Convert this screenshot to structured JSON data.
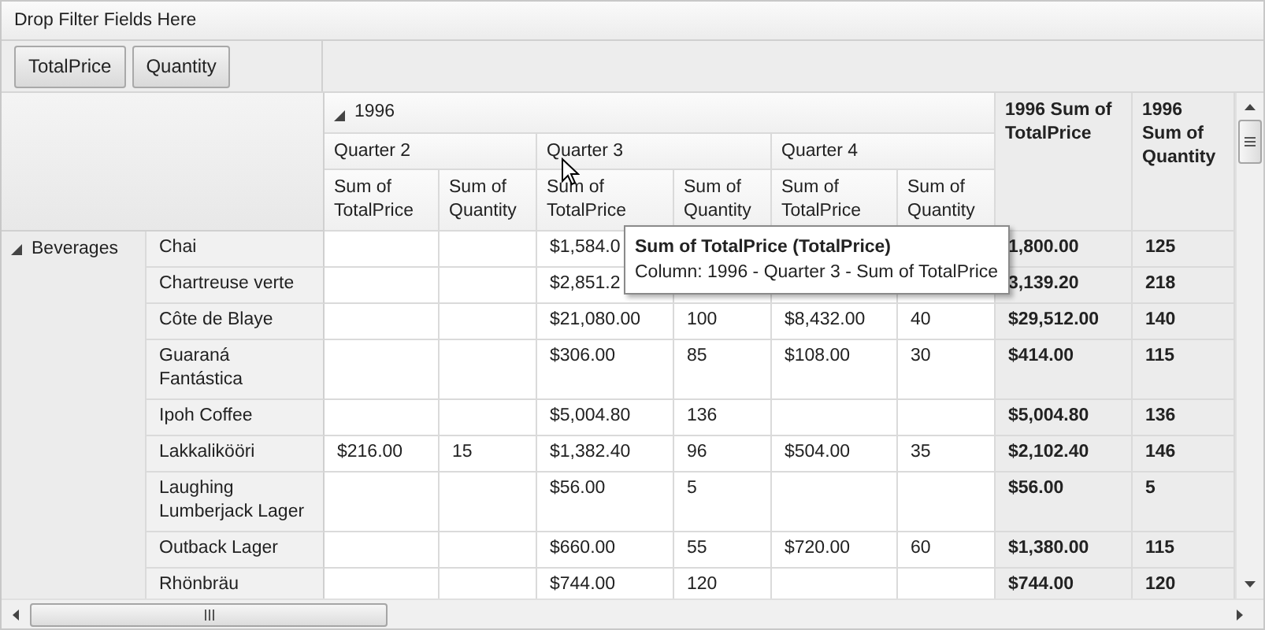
{
  "filter_drop_zone": "Drop Filter Fields Here",
  "data_fields": [
    "TotalPrice",
    "Quantity"
  ],
  "column_group": {
    "label": "1996",
    "expanded": true
  },
  "quarters": [
    {
      "label": "Quarter 2",
      "measures": [
        "Sum of TotalPrice",
        "Sum of Quantity"
      ]
    },
    {
      "label": "Quarter 3",
      "measures": [
        "Sum of TotalPrice",
        "Sum of Quantity"
      ]
    },
    {
      "label": "Quarter 4",
      "measures": [
        "Sum of TotalPrice",
        "Sum of Quantity"
      ]
    }
  ],
  "grand_totals": [
    "1996 Sum of TotalPrice",
    "1996 Sum of Quantity"
  ],
  "row_group": {
    "label": "Beverages",
    "expanded": true
  },
  "rows": [
    {
      "product": "Chai",
      "cells": [
        null,
        null,
        "$1,584.0"
      ],
      "totals": [
        "1,800.00",
        "125"
      ]
    },
    {
      "product": "Chartreuse verte",
      "cells": [
        null,
        null,
        "$2,851.2",
        null,
        null,
        null
      ],
      "totals": [
        "3,139.20",
        "218"
      ]
    },
    {
      "product": "Côte de Blaye",
      "cells": [
        null,
        null,
        "$21,080.00",
        "100",
        "$8,432.00",
        "40"
      ],
      "totals": [
        "$29,512.00",
        "140"
      ]
    },
    {
      "product": "Guaraná Fantástica",
      "cells": [
        null,
        null,
        "$306.00",
        "85",
        "$108.00",
        "30"
      ],
      "totals": [
        "$414.00",
        "115"
      ]
    },
    {
      "product": "Ipoh Coffee",
      "cells": [
        null,
        null,
        "$5,004.80",
        "136",
        null,
        null
      ],
      "totals": [
        "$5,004.80",
        "136"
      ]
    },
    {
      "product": "Lakkalikööri",
      "cells": [
        "$216.00",
        "15",
        "$1,382.40",
        "96",
        "$504.00",
        "35"
      ],
      "totals": [
        "$2,102.40",
        "146"
      ]
    },
    {
      "product": "Laughing Lumberjack Lager",
      "cells": [
        null,
        null,
        "$56.00",
        "5",
        null,
        null
      ],
      "totals": [
        "$56.00",
        "5"
      ]
    },
    {
      "product": "Outback Lager",
      "cells": [
        null,
        null,
        "$660.00",
        "55",
        "$720.00",
        "60"
      ],
      "totals": [
        "$1,380.00",
        "115"
      ]
    },
    {
      "product": "Rhönbräu",
      "cells": [
        null,
        null,
        "$744.00",
        "120",
        null,
        null
      ],
      "totals": [
        "$744.00",
        "120"
      ]
    }
  ],
  "tooltip": {
    "title": "Sum of TotalPrice (TotalPrice)",
    "text": "Column: 1996 - Quarter 3 - Sum of TotalPrice"
  }
}
